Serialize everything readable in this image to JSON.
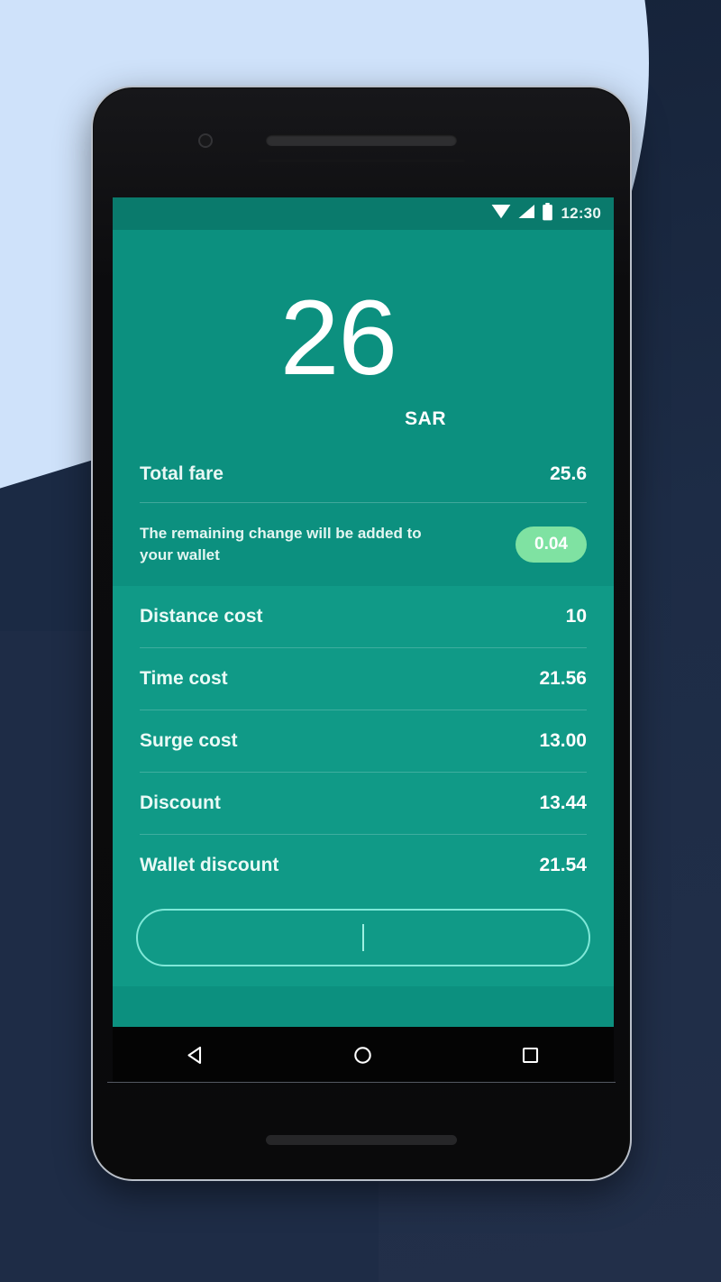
{
  "device": {
    "frame": "android-phone-mockup",
    "accent_color": "#0c907f",
    "panel_color": "#109a87",
    "badge_color": "#7fe2a2"
  },
  "status_bar": {
    "clock": "12:30",
    "icons": [
      "wifi-icon",
      "cellular-signal-icon",
      "battery-icon"
    ]
  },
  "hero": {
    "amount": "26",
    "currency": "SAR"
  },
  "summary": {
    "total_fare": {
      "label": "Total fare",
      "value": "25.6"
    },
    "change_note": {
      "text": "The remaining change will be added to your wallet",
      "badge": "0.04"
    }
  },
  "breakdown": {
    "rows": [
      {
        "label": "Distance cost",
        "value": "10"
      },
      {
        "label": "Time cost",
        "value": "21.56"
      },
      {
        "label": "Surge cost",
        "value": "13.00"
      },
      {
        "label": "Discount",
        "value": "13.44"
      },
      {
        "label": "Wallet discount",
        "value": "21.54"
      }
    ]
  },
  "action_field": {
    "value": "",
    "placeholder": ""
  },
  "nav_bar": {
    "back": "back-triangle-icon",
    "home": "home-circle-icon",
    "recents": "recents-square-icon"
  }
}
